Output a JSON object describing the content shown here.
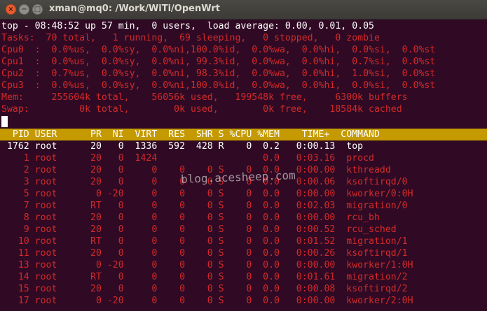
{
  "window": {
    "title": "xman@mq0: /Work/WiTi/OpenWrt",
    "close_glyph": "×",
    "minimize_glyph": "−",
    "maximize_glyph": "□"
  },
  "top": {
    "summary": "top - 08:48:52 up 57 min,  0 users,  load average: 0.00, 0.01, 0.05",
    "tasks": "Tasks:  70 total,   1 running,  69 sleeping,   0 stopped,   0 zombie",
    "cpus": [
      "Cpu0  :  0.0%us,  0.0%sy,  0.0%ni,100.0%id,  0.0%wa,  0.0%hi,  0.0%si,  0.0%st",
      "Cpu1  :  0.0%us,  0.0%sy,  0.0%ni, 99.3%id,  0.0%wa,  0.0%hi,  0.7%si,  0.0%st",
      "Cpu2  :  0.7%us,  0.0%sy,  0.0%ni, 98.3%id,  0.0%wa,  0.0%hi,  1.0%si,  0.0%st",
      "Cpu3  :  0.0%us,  0.0%sy,  0.0%ni,100.0%id,  0.0%wa,  0.0%hi,  0.0%si,  0.0%st"
    ],
    "mem": "Mem:     255604k total,    56056k used,   199548k free,     6300k buffers",
    "swap": "Swap:         0k total,        0k used,        0k free,    18584k cached",
    "column_header": "  PID USER      PR  NI  VIRT  RES  SHR S %CPU %MEM    TIME+  COMMAND",
    "processes": [
      {
        "pid": "1762",
        "user": "root",
        "pr": "20",
        "ni": "0",
        "virt": "1336",
        "res": "592",
        "shr": "428",
        "s": "R",
        "cpu": "0",
        "mem": "0.2",
        "time": "0:00.13",
        "command": "top"
      },
      {
        "pid": "1",
        "user": "root",
        "pr": "20",
        "ni": "0",
        "virt": "1424",
        "res": "",
        "shr": "",
        "s": "",
        "cpu": "",
        "mem": "0.0",
        "time": "0:03.16",
        "command": "procd"
      },
      {
        "pid": "2",
        "user": "root",
        "pr": "20",
        "ni": "0",
        "virt": "0",
        "res": "0",
        "shr": "0",
        "s": "S",
        "cpu": "0",
        "mem": "0.0",
        "time": "0:00.00",
        "command": "kthreadd"
      },
      {
        "pid": "3",
        "user": "root",
        "pr": "20",
        "ni": "0",
        "virt": "0",
        "res": "0",
        "shr": "0",
        "s": "S",
        "cpu": "0",
        "mem": "0.0",
        "time": "0:00.06",
        "command": "ksoftirqd/0"
      },
      {
        "pid": "5",
        "user": "root",
        "pr": "0",
        "ni": "-20",
        "virt": "0",
        "res": "0",
        "shr": "0",
        "s": "S",
        "cpu": "0",
        "mem": "0.0",
        "time": "0:00.00",
        "command": "kworker/0:0H"
      },
      {
        "pid": "7",
        "user": "root",
        "pr": "RT",
        "ni": "0",
        "virt": "0",
        "res": "0",
        "shr": "0",
        "s": "S",
        "cpu": "0",
        "mem": "0.0",
        "time": "0:02.03",
        "command": "migration/0"
      },
      {
        "pid": "8",
        "user": "root",
        "pr": "20",
        "ni": "0",
        "virt": "0",
        "res": "0",
        "shr": "0",
        "s": "S",
        "cpu": "0",
        "mem": "0.0",
        "time": "0:00.00",
        "command": "rcu_bh"
      },
      {
        "pid": "9",
        "user": "root",
        "pr": "20",
        "ni": "0",
        "virt": "0",
        "res": "0",
        "shr": "0",
        "s": "S",
        "cpu": "0",
        "mem": "0.0",
        "time": "0:00.52",
        "command": "rcu_sched"
      },
      {
        "pid": "10",
        "user": "root",
        "pr": "RT",
        "ni": "0",
        "virt": "0",
        "res": "0",
        "shr": "0",
        "s": "S",
        "cpu": "0",
        "mem": "0.0",
        "time": "0:01.52",
        "command": "migration/1"
      },
      {
        "pid": "11",
        "user": "root",
        "pr": "20",
        "ni": "0",
        "virt": "0",
        "res": "0",
        "shr": "0",
        "s": "S",
        "cpu": "0",
        "mem": "0.0",
        "time": "0:00.26",
        "command": "ksoftirqd/1"
      },
      {
        "pid": "13",
        "user": "root",
        "pr": "0",
        "ni": "-20",
        "virt": "0",
        "res": "0",
        "shr": "0",
        "s": "S",
        "cpu": "0",
        "mem": "0.0",
        "time": "0:00.00",
        "command": "kworker/1:0H"
      },
      {
        "pid": "14",
        "user": "root",
        "pr": "RT",
        "ni": "0",
        "virt": "0",
        "res": "0",
        "shr": "0",
        "s": "S",
        "cpu": "0",
        "mem": "0.0",
        "time": "0:01.61",
        "command": "migration/2"
      },
      {
        "pid": "15",
        "user": "root",
        "pr": "20",
        "ni": "0",
        "virt": "0",
        "res": "0",
        "shr": "0",
        "s": "S",
        "cpu": "0",
        "mem": "0.0",
        "time": "0:00.08",
        "command": "ksoftirqd/2"
      },
      {
        "pid": "17",
        "user": "root",
        "pr": "0",
        "ni": "-20",
        "virt": "0",
        "res": "0",
        "shr": "0",
        "s": "S",
        "cpu": "0",
        "mem": "0.0",
        "time": "0:00.00",
        "command": "kworker/2:0H"
      }
    ]
  },
  "watermark": "blog.acesheep.com",
  "colors": {
    "terminal_bg": "#300a24",
    "text_white": "#ffffff",
    "text_red": "#d22a2a",
    "header_bar": "#c49a00"
  }
}
